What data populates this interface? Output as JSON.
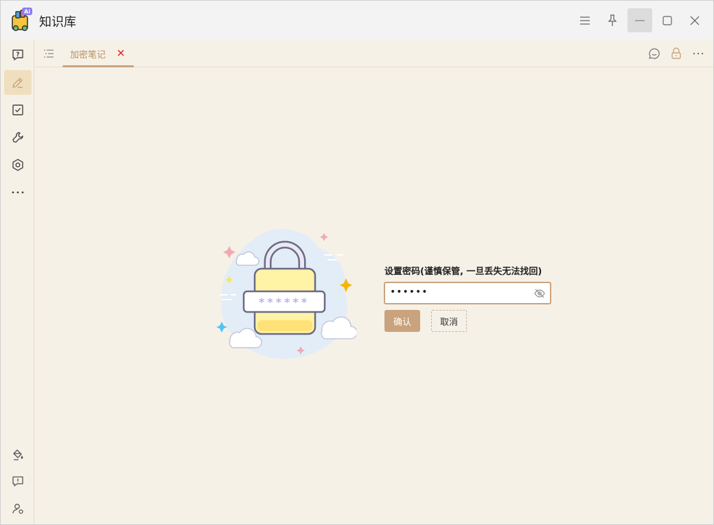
{
  "app": {
    "title": "知识库",
    "logo_badge": "Ai"
  },
  "titlebar": {
    "icons": [
      "menu-icon",
      "pin-icon",
      "minimize-icon",
      "maximize-icon",
      "close-icon"
    ]
  },
  "sidebar": {
    "items": [
      {
        "name": "question-chat",
        "icon": "question-bubble-icon"
      },
      {
        "name": "notes",
        "icon": "pencil-icon",
        "active": true
      },
      {
        "name": "tasks",
        "icon": "checkbox-icon"
      },
      {
        "name": "tools",
        "icon": "wrench-icon"
      },
      {
        "name": "plugins",
        "icon": "hexagon-icon"
      },
      {
        "name": "more",
        "icon": "more-icon"
      }
    ],
    "bottom_items": [
      {
        "name": "theme",
        "icon": "paint-bucket-icon"
      },
      {
        "name": "feedback",
        "icon": "feedback-icon"
      },
      {
        "name": "account",
        "icon": "user-settings-icon"
      }
    ]
  },
  "tabbar": {
    "tab_label": "加密笔记",
    "right_icons": [
      "comment-icon",
      "lock-icon",
      "more-icon"
    ]
  },
  "lock_form": {
    "title": "设置密码(谨慎保管, 一旦丢失无法找回)",
    "password_value": "••••••",
    "confirm_label": "确认",
    "cancel_label": "取消",
    "illustration_text": "******"
  },
  "colors": {
    "accent": "#c9a37e",
    "background": "#f6f1e7",
    "tab_close": "#e02020"
  }
}
